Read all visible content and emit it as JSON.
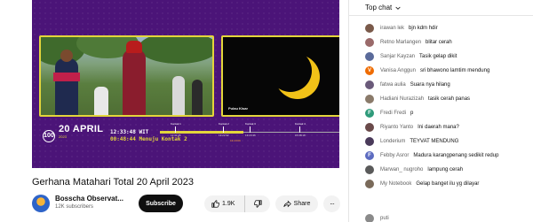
{
  "video": {
    "date": "20 APRIL",
    "date_sub": "2023",
    "badge": "100",
    "clock_local": "12:33:48 WIT",
    "countdown": "00:48:44 Menuju Kontak 2",
    "cam2_location": "Pulau Kisar",
    "ticks": [
      {
        "label": "Kontak 1",
        "time": "11:42:28"
      },
      {
        "label": "Kontak 2",
        "time": "13:22:32"
      },
      {
        "label": "Kontak 3",
        "time": "13:23:46"
      },
      {
        "label": "Kontak 4",
        "time": "15:08:18"
      }
    ],
    "peak_time": "13:23:09"
  },
  "meta": {
    "title": "Gerhana Matahari Total 20 April 2023",
    "channel": "Bosscha Observat...",
    "subscribers": "12K subscribers",
    "subscribe_label": "Subscribe",
    "likes": "1.9K",
    "share_label": "Share"
  },
  "chat": {
    "header": "Top chat",
    "messages": [
      {
        "author": "irawan lek",
        "text": "bjn kdm hdir",
        "initial": "",
        "color": "#7a5a4a"
      },
      {
        "author": "Retno Marlangen",
        "text": "blitar cerah",
        "initial": "",
        "color": "#9a6a6a"
      },
      {
        "author": "Sanjar Kayzan",
        "text": "Tasik gelap dikit",
        "initial": "",
        "color": "#5a6a9a"
      },
      {
        "author": "Vanisa Anggun",
        "text": "sri bhawono lamtim mendung",
        "initial": "V",
        "color": "#ef6c00"
      },
      {
        "author": "fatwa aulia",
        "text": "Suara nya hilang",
        "initial": "",
        "color": "#6a5a7a"
      },
      {
        "author": "Hadiani Nurazizah",
        "text": "tasik cerah panas",
        "initial": "",
        "color": "#8a7a6a"
      },
      {
        "author": "Fredi Fredi",
        "text": "p",
        "initial": "F",
        "color": "#2e9a7a"
      },
      {
        "author": "Riyanto Yanto",
        "text": "Ini daerah mana?",
        "initial": "",
        "color": "#6a4a4a"
      },
      {
        "author": "Londerium",
        "text": "TEYVAT MENDUNG",
        "initial": "",
        "color": "#4a3a5a"
      },
      {
        "author": "Febby Asror",
        "text": "Madura karangpenang sedikit redup",
        "initial": "F",
        "color": "#5c6bc0"
      },
      {
        "author": "Marwan_ nugroho",
        "text": "lampung cerah",
        "initial": "",
        "color": "#5a5a5a"
      },
      {
        "author": "My Notebook",
        "text": "Gelap banget ilu yg dilayar",
        "initial": "",
        "color": "#7a6a5a"
      }
    ],
    "footer_author": "puti"
  },
  "colors": {
    "player_bg": "#4b1478",
    "accent_yellow": "#e3d53b",
    "subscribe_bg": "#0f0f0f"
  }
}
